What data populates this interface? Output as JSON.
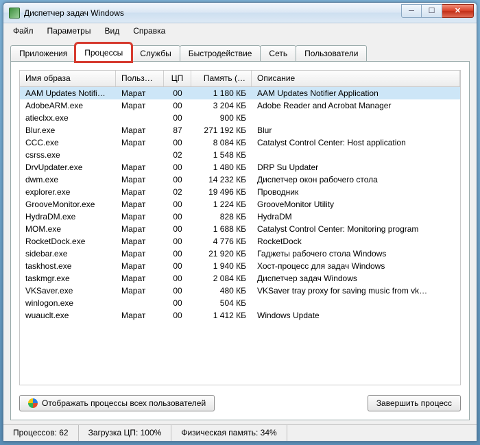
{
  "window": {
    "title": "Диспетчер задач Windows"
  },
  "menu": [
    "Файл",
    "Параметры",
    "Вид",
    "Справка"
  ],
  "tabs": [
    "Приложения",
    "Процессы",
    "Службы",
    "Быстродействие",
    "Сеть",
    "Пользователи"
  ],
  "active_tab_index": 1,
  "columns": {
    "image": "Имя образа",
    "user": "Польз…",
    "cpu": "ЦП",
    "mem": "Память (…",
    "desc": "Описание"
  },
  "selected_row_index": 0,
  "rows": [
    {
      "image": "AAM Updates Notifi…",
      "user": "Марат",
      "cpu": "00",
      "mem": "1 180 КБ",
      "desc": "AAM Updates Notifier Application"
    },
    {
      "image": "AdobeARM.exe",
      "user": "Марат",
      "cpu": "00",
      "mem": "3 204 КБ",
      "desc": "Adobe Reader and Acrobat Manager"
    },
    {
      "image": "atieclxx.exe",
      "user": "",
      "cpu": "00",
      "mem": "900 КБ",
      "desc": ""
    },
    {
      "image": "Blur.exe",
      "user": "Марат",
      "cpu": "87",
      "mem": "271 192 КБ",
      "desc": "Blur"
    },
    {
      "image": "CCC.exe",
      "user": "Марат",
      "cpu": "00",
      "mem": "8 084 КБ",
      "desc": "Catalyst Control Center: Host application"
    },
    {
      "image": "csrss.exe",
      "user": "",
      "cpu": "02",
      "mem": "1 548 КБ",
      "desc": ""
    },
    {
      "image": "DrvUpdater.exe",
      "user": "Марат",
      "cpu": "00",
      "mem": "1 480 КБ",
      "desc": "DRP Su Updater"
    },
    {
      "image": "dwm.exe",
      "user": "Марат",
      "cpu": "00",
      "mem": "14 232 КБ",
      "desc": "Диспетчер окон рабочего стола"
    },
    {
      "image": "explorer.exe",
      "user": "Марат",
      "cpu": "02",
      "mem": "19 496 КБ",
      "desc": "Проводник"
    },
    {
      "image": "GrooveMonitor.exe",
      "user": "Марат",
      "cpu": "00",
      "mem": "1 224 КБ",
      "desc": "GrooveMonitor Utility"
    },
    {
      "image": "HydraDM.exe",
      "user": "Марат",
      "cpu": "00",
      "mem": "828 КБ",
      "desc": "HydraDM"
    },
    {
      "image": "MOM.exe",
      "user": "Марат",
      "cpu": "00",
      "mem": "1 688 КБ",
      "desc": "Catalyst Control Center: Monitoring program"
    },
    {
      "image": "RocketDock.exe",
      "user": "Марат",
      "cpu": "00",
      "mem": "4 776 КБ",
      "desc": "RocketDock"
    },
    {
      "image": "sidebar.exe",
      "user": "Марат",
      "cpu": "00",
      "mem": "21 920 КБ",
      "desc": "Гаджеты рабочего стола Windows"
    },
    {
      "image": "taskhost.exe",
      "user": "Марат",
      "cpu": "00",
      "mem": "1 940 КБ",
      "desc": "Хост-процесс для задач Windows"
    },
    {
      "image": "taskmgr.exe",
      "user": "Марат",
      "cpu": "00",
      "mem": "2 084 КБ",
      "desc": "Диспетчер задач Windows"
    },
    {
      "image": "VKSaver.exe",
      "user": "Марат",
      "cpu": "00",
      "mem": "480 КБ",
      "desc": "VKSaver tray proxy for saving music from vk…"
    },
    {
      "image": "winlogon.exe",
      "user": "",
      "cpu": "00",
      "mem": "504 КБ",
      "desc": ""
    },
    {
      "image": "wuauclt.exe",
      "user": "Марат",
      "cpu": "00",
      "mem": "1 412 КБ",
      "desc": "Windows Update"
    }
  ],
  "buttons": {
    "show_all_users": "Отображать процессы всех пользователей",
    "end_process": "Завершить процесс"
  },
  "status": {
    "processes": "Процессов: 62",
    "cpu": "Загрузка ЦП: 100%",
    "mem": "Физическая память: 34%"
  }
}
